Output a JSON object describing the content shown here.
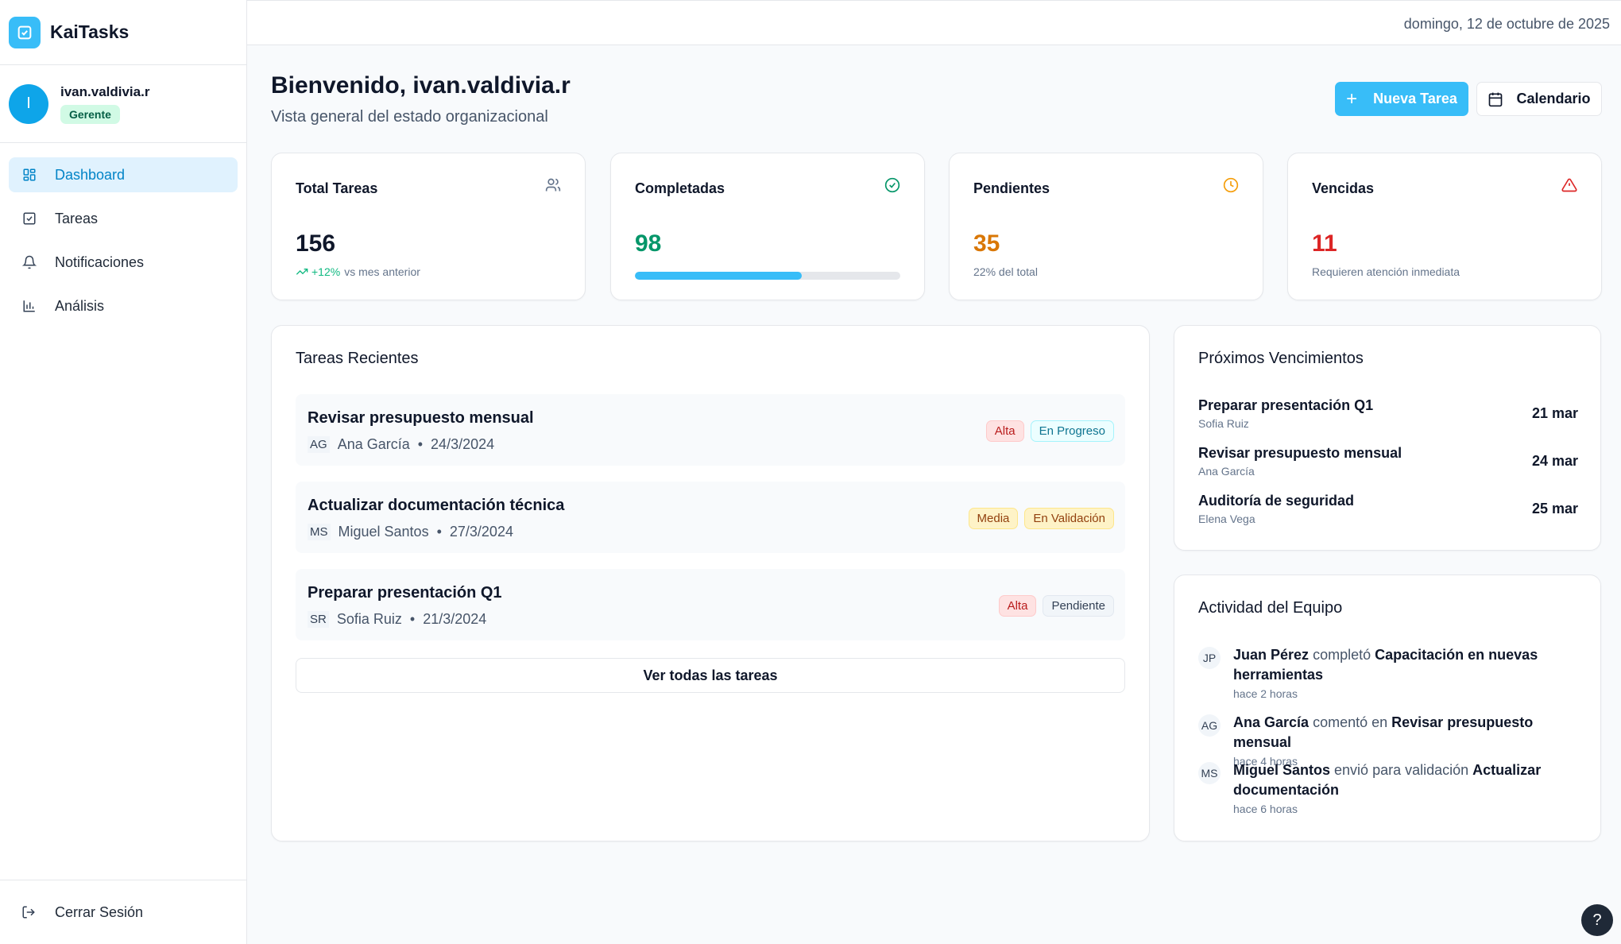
{
  "app": {
    "name": "KaiTasks"
  },
  "user": {
    "name": "ivan.valdivia.r",
    "initial": "I",
    "role": "Gerente"
  },
  "sidebar": {
    "items": [
      {
        "label": "Dashboard",
        "icon": "grid-icon",
        "active": true
      },
      {
        "label": "Tareas",
        "icon": "checkbox-icon"
      },
      {
        "label": "Notificaciones",
        "icon": "bell-icon"
      },
      {
        "label": "Análisis",
        "icon": "bar-chart-icon"
      }
    ],
    "logout": "Cerrar Sesión"
  },
  "header": {
    "date": "domingo, 12 de octubre de 2025"
  },
  "welcome": {
    "title": "Bienvenido, ivan.valdivia.r",
    "subtitle": "Vista general del estado organizacional",
    "new_task": "Nueva Tarea",
    "calendar": "Calendario"
  },
  "stats": {
    "total": {
      "title": "Total Tareas",
      "value": "156",
      "trend": "+12%",
      "foot": "vs mes anterior",
      "icon": "users-icon"
    },
    "completed": {
      "title": "Completadas",
      "value": "98",
      "progress": 0.628,
      "icon": "check-circle-icon"
    },
    "pending": {
      "title": "Pendientes",
      "value": "35",
      "foot": "22% del total",
      "icon": "clock-icon"
    },
    "overdue": {
      "title": "Vencidas",
      "value": "11",
      "foot": "Requieren atención inmediata",
      "icon": "alert-triangle-icon"
    }
  },
  "colors": {
    "accent": "#38bdf8",
    "success": "#059669",
    "warning": "#d97706",
    "danger": "#dc2626"
  },
  "recent": {
    "title": "Tareas Recientes",
    "tasks": [
      {
        "title": "Revisar presupuesto mensual",
        "initials": "AG",
        "assignee": "Ana García",
        "date": "24/3/2024",
        "priority": "Alta",
        "status": "En Progreso"
      },
      {
        "title": "Actualizar documentación técnica",
        "initials": "MS",
        "assignee": "Miguel Santos",
        "date": "27/3/2024",
        "priority": "Media",
        "status": "En Validación"
      },
      {
        "title": "Preparar presentación Q1",
        "initials": "SR",
        "assignee": "Sofia Ruiz",
        "date": "21/3/2024",
        "priority": "Alta",
        "status": "Pendiente"
      }
    ],
    "view_all": "Ver todas las tareas"
  },
  "upcoming": {
    "title": "Próximos Vencimientos",
    "items": [
      {
        "title": "Preparar presentación Q1",
        "person": "Sofia Ruiz",
        "date": "21 mar"
      },
      {
        "title": "Revisar presupuesto mensual",
        "person": "Ana García",
        "date": "24 mar"
      },
      {
        "title": "Auditoría de seguridad",
        "person": "Elena Vega",
        "date": "25 mar"
      }
    ]
  },
  "activity": {
    "title": "Actividad del Equipo",
    "items": [
      {
        "initials": "JP",
        "name": "Juan Pérez",
        "action": "completó",
        "target": "Capacitación en nuevas herramientas",
        "time": "hace 2 horas"
      },
      {
        "initials": "AG",
        "name": "Ana García",
        "action": "comentó en",
        "target": "Revisar presupuesto mensual",
        "time": "hace 4 horas"
      },
      {
        "initials": "MS",
        "name": "Miguel Santos",
        "action": "envió para validación",
        "target": "Actualizar documentación",
        "time": "hace 6 horas"
      }
    ]
  },
  "help": {
    "label": "?"
  }
}
